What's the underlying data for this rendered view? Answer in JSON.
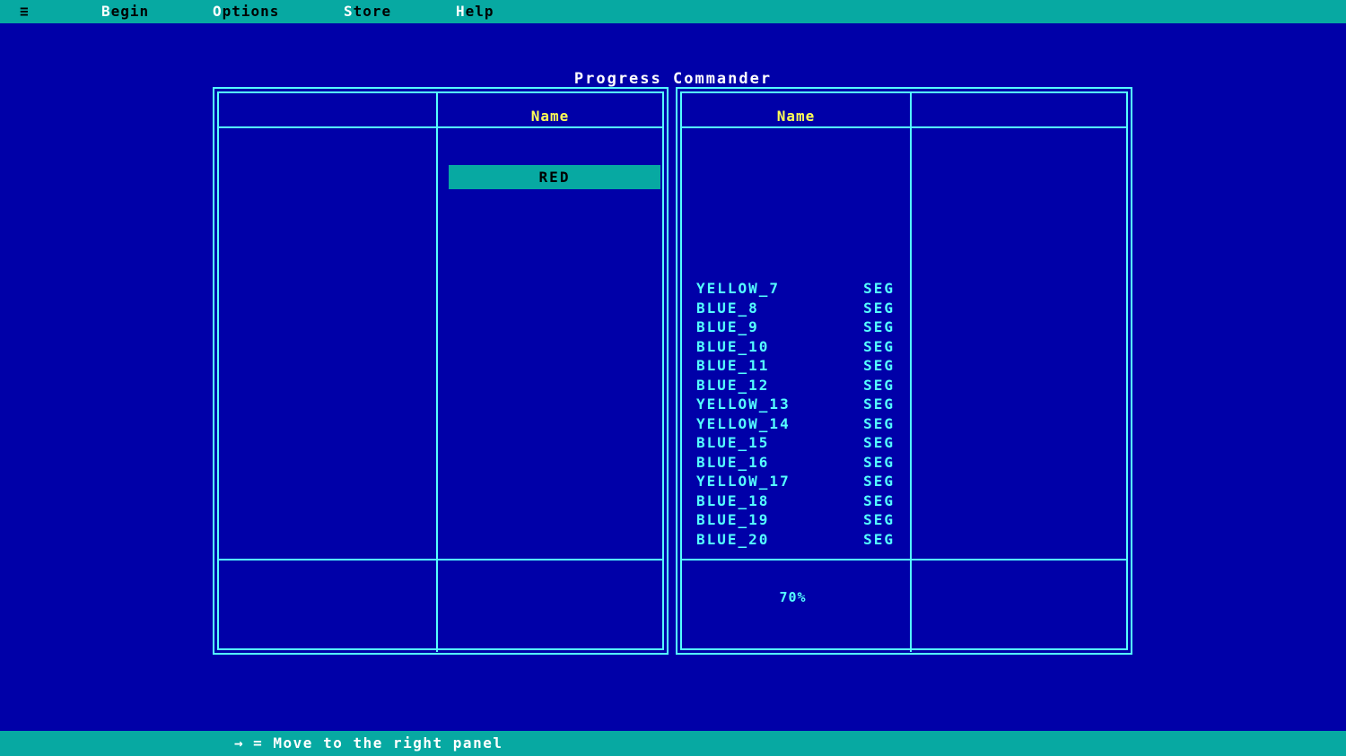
{
  "app": {
    "title": "Progress Commander"
  },
  "menubar": {
    "menu_icon": "≡",
    "items": [
      {
        "hot": "B",
        "rest": "egin"
      },
      {
        "hot": "O",
        "rest": "ptions"
      },
      {
        "hot": "S",
        "rest": "tore"
      },
      {
        "hot": "H",
        "rest": "elp"
      }
    ]
  },
  "left_panel": {
    "column_header": "Name",
    "selected_file": "RED"
  },
  "right_panel": {
    "column_header": "Name",
    "files": [
      {
        "name": "YELLOW_7",
        "ext": "SEG"
      },
      {
        "name": "BLUE_8",
        "ext": "SEG"
      },
      {
        "name": "BLUE_9",
        "ext": "SEG"
      },
      {
        "name": "BLUE_10",
        "ext": "SEG"
      },
      {
        "name": "BLUE_11",
        "ext": "SEG"
      },
      {
        "name": "BLUE_12",
        "ext": "SEG"
      },
      {
        "name": "YELLOW_13",
        "ext": "SEG"
      },
      {
        "name": "YELLOW_14",
        "ext": "SEG"
      },
      {
        "name": "BLUE_15",
        "ext": "SEG"
      },
      {
        "name": "BLUE_16",
        "ext": "SEG"
      },
      {
        "name": "YELLOW_17",
        "ext": "SEG"
      },
      {
        "name": "BLUE_18",
        "ext": "SEG"
      },
      {
        "name": "BLUE_19",
        "ext": "SEG"
      },
      {
        "name": "BLUE_20",
        "ext": "SEG"
      }
    ],
    "progress_percent": "70%"
  },
  "statusbar": {
    "arrow": "→",
    "text": "= Move to the right panel"
  },
  "colors": {
    "background": "#0000A8",
    "bar_teal": "#07A9A2",
    "border_cyan": "#55FFFF",
    "header_yellow": "#FFFF55",
    "file_cyan": "#55FFFF",
    "title_white": "#FFFFFF"
  }
}
